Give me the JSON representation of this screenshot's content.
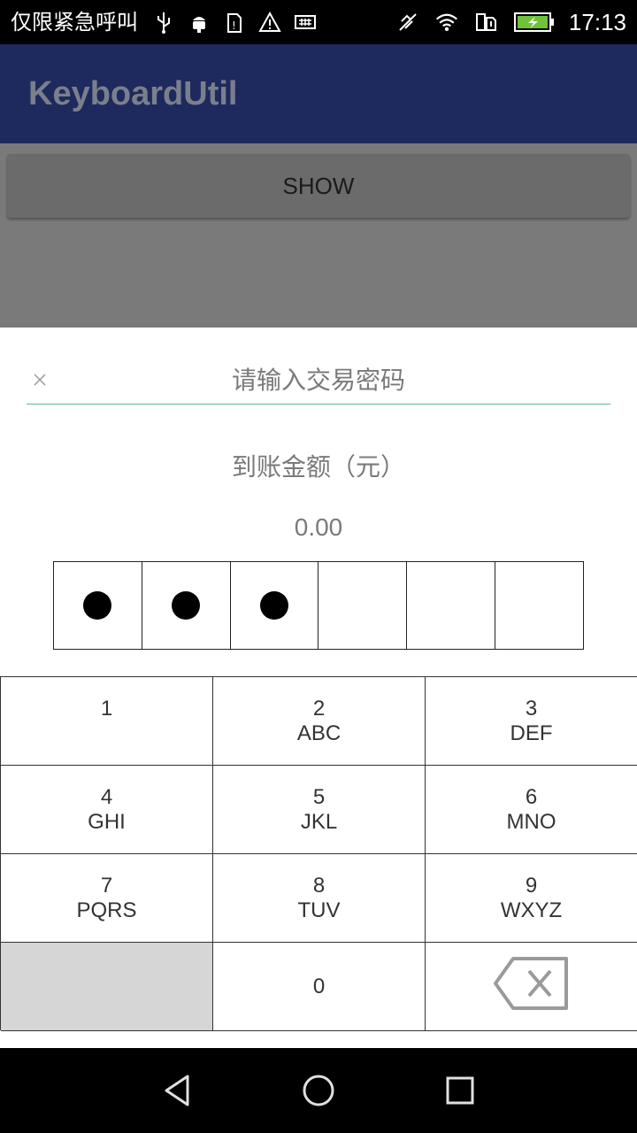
{
  "status_bar": {
    "carrier": "仅限紧急呼叫",
    "time": "17:13",
    "left_icons": [
      "usb-icon",
      "android-debug-icon",
      "sim-warning-icon",
      "warning-icon",
      "keyboard-icon"
    ],
    "right_icons": [
      "mute-icon",
      "wifi-icon",
      "sim-icon",
      "battery-charging-icon"
    ]
  },
  "app_bar": {
    "title": "KeyboardUtil"
  },
  "content": {
    "show_button_label": "SHOW"
  },
  "sheet": {
    "title": "请输入交易密码",
    "amount_label": "到账金额（元）",
    "amount_value": "0.00",
    "password_length": 6,
    "filled_count": 3
  },
  "keypad": {
    "keys": [
      {
        "num": "1",
        "letters": ""
      },
      {
        "num": "2",
        "letters": "ABC"
      },
      {
        "num": "3",
        "letters": "DEF"
      },
      {
        "num": "4",
        "letters": "GHI"
      },
      {
        "num": "5",
        "letters": "JKL"
      },
      {
        "num": "6",
        "letters": "MNO"
      },
      {
        "num": "7",
        "letters": "PQRS"
      },
      {
        "num": "8",
        "letters": "TUV"
      },
      {
        "num": "9",
        "letters": "WXYZ"
      },
      {
        "num": "",
        "letters": ""
      },
      {
        "num": "0",
        "letters": ""
      },
      {
        "num": "",
        "letters": ""
      }
    ]
  },
  "colors": {
    "app_bar": "#1e2a5e",
    "overlay": "#7a7a7a",
    "divider": "#5fb3a3",
    "empty_key": "#d6d6d6"
  }
}
